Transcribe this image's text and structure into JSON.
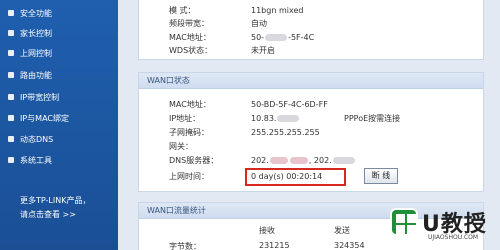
{
  "sidebar": {
    "items": [
      {
        "label": "安全功能"
      },
      {
        "label": "家长控制"
      },
      {
        "label": "上网控制"
      },
      {
        "label": "路由功能"
      },
      {
        "label": "IP带宽控制"
      },
      {
        "label": "IP与MAC绑定"
      },
      {
        "label": "动态DNS"
      },
      {
        "label": "系统工具"
      }
    ],
    "promo_line1": "更多TP-LINK产品，",
    "promo_line2": "请点击查看 >>"
  },
  "wireless": {
    "mode_label": "模 式：",
    "mode_value": "11bgn mixed",
    "bandwidth_label": "频段带宽：",
    "bandwidth_value": "自动",
    "mac_label": "MAC地址：",
    "mac_value_prefix": "50-",
    "mac_value_suffix": "-5F-4C",
    "wds_label": "WDS状态：",
    "wds_value": "未开启"
  },
  "wan": {
    "title": "WAN口状态",
    "mac_label": "MAC地址：",
    "mac_value": "50-BD-5F-4C-6D-FF",
    "ip_label": "IP地址：",
    "ip_value": "10.83.",
    "ip_type": "PPPoE按需连接",
    "mask_label": "子网掩码：",
    "mask_value": "255.255.255.255",
    "gateway_label": "网关：",
    "gateway_value": "",
    "dns_label": "DNS服务器：",
    "dns_value_1": "202.",
    "dns_value_2": ", 202.",
    "uptime_label": "上网时间：",
    "uptime_value": "0 day(s) 00:20:14",
    "disconnect_label": "断 线"
  },
  "traffic": {
    "title": "WAN口流量统计",
    "col_receive": "接收",
    "col_send": "发送",
    "bytes_label": "字节数：",
    "bytes_receive": "231215",
    "bytes_send": "324354"
  },
  "watermark": {
    "brand": "U教授",
    "url": "UJIAOSHOU.COM"
  },
  "colors": {
    "sidebar_bg": "#1f5fae",
    "highlight_border": "#d6281e",
    "logo_green": "#1f8f3a"
  }
}
